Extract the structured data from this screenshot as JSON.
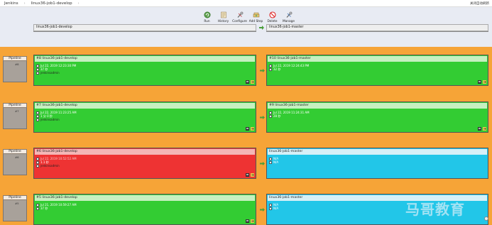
{
  "breadcrumb": {
    "root": "Jenkins",
    "separator": "›",
    "current": "linux36-job1-develop"
  },
  "top_right": "关闭自动刷新",
  "toolbar": [
    {
      "label": "Run",
      "icon": "run-icon"
    },
    {
      "label": "History",
      "icon": "history-icon"
    },
    {
      "label": "Configure",
      "icon": "configure-icon"
    },
    {
      "label": "Add Step",
      "icon": "add-step-icon"
    },
    {
      "label": "Delete",
      "icon": "delete-icon"
    },
    {
      "label": "Manage",
      "icon": "manage-icon"
    }
  ],
  "stages": {
    "first": "linux36-job1-develop",
    "second": "linux36-job1-master"
  },
  "pipelines": [
    {
      "label": "Pipeline",
      "num": "#8",
      "left": {
        "status": "green",
        "title": "#8 linux36-job1-develop",
        "date": "Jul 22, 2019 12:23:30 PM",
        "duration": "37 秒",
        "user": "jenkinsadmin"
      },
      "right": {
        "status": "green",
        "title": "#10 linux36-job1-master",
        "date": "Jul 22, 2019 12:24:43 PM",
        "duration": "32 秒"
      }
    },
    {
      "label": "Pipeline",
      "num": "#7",
      "left": {
        "status": "green",
        "title": "#7 linux36-job1-develop",
        "date": "Jul 22, 2019 11:23:25 AM",
        "duration": "1 分 0 秒",
        "user": "jenkinsadmin"
      },
      "right": {
        "status": "green",
        "title": "#9 linux36-job1-master",
        "date": "Jul 22, 2019 11:24:31 AM",
        "duration": "28 秒"
      }
    },
    {
      "label": "Pipeline",
      "num": "#6",
      "left": {
        "status": "red",
        "title": "#6 linux36-job1-develop",
        "date": "Jul 22, 2019 10:52:52 AM",
        "duration": "1.1 秒",
        "user": "jenkinsadmin"
      },
      "right": {
        "status": "cyan",
        "title": "linux36-job1-master",
        "date": "N/A",
        "duration": "N/A"
      }
    },
    {
      "label": "Pipeline",
      "num": "#5",
      "left": {
        "status": "green",
        "title": "#5 linux36-job1-develop",
        "date": "Jul 21, 2019 10:59:27 AM",
        "duration": "37 秒"
      },
      "right": {
        "status": "cyan",
        "title": "linux36-job1-master",
        "date": "N/A",
        "duration": "N/A"
      }
    }
  ],
  "watermark": "马哥教育",
  "colors": {
    "green": "#33cc33",
    "red": "#ee3333",
    "cyan": "#22c6e8",
    "orange": "#f6a437"
  }
}
